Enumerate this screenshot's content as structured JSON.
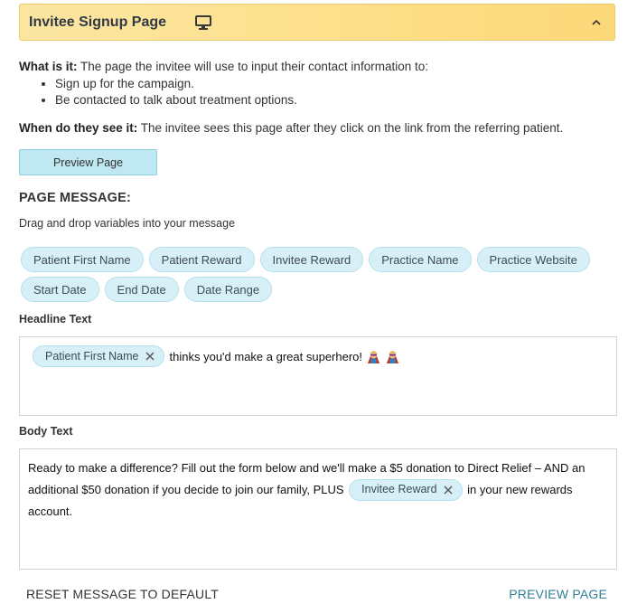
{
  "header": {
    "title": "Invitee Signup Page",
    "monitor_icon": "monitor-icon",
    "collapse_icon": "chevron-up-icon"
  },
  "intro": {
    "what_label": "What is it:",
    "what_text": " The page the invitee will use to input their contact information to:",
    "bullets": [
      "Sign up for the campaign.",
      "Be contacted to talk about treatment options."
    ],
    "when_label": "When do they see it:",
    "when_text": " The invitee sees this page after they click on the link from the referring patient."
  },
  "preview_button": "Preview Page",
  "page_message": {
    "title": "PAGE MESSAGE:",
    "hint": "Drag and drop variables into your message",
    "variables_row1": [
      "Patient First Name",
      "Patient Reward",
      "Invitee Reward",
      "Practice Name",
      "Practice Website"
    ],
    "variables_row2": [
      "Start Date",
      "End Date",
      "Date Range"
    ]
  },
  "headline": {
    "label": "Headline Text",
    "chip": "Patient First Name",
    "text": "thinks you'd make a great superhero!"
  },
  "body": {
    "label": "Body Text",
    "text_before": "Ready to make a difference? Fill out the form below and we'll make a $5 donation to Direct Relief – AND an additional $50 donation if you decide to join our family, PLUS",
    "chip": "Invitee Reward",
    "text_after": "in your new rewards account."
  },
  "footer": {
    "reset": "RESET MESSAGE TO DEFAULT",
    "preview": "PREVIEW PAGE"
  },
  "colors": {
    "header_bg": "#fde08c",
    "chip_bg": "#d7f0f7",
    "button_bg": "#bfe8f2",
    "link": "#2f7f95"
  }
}
